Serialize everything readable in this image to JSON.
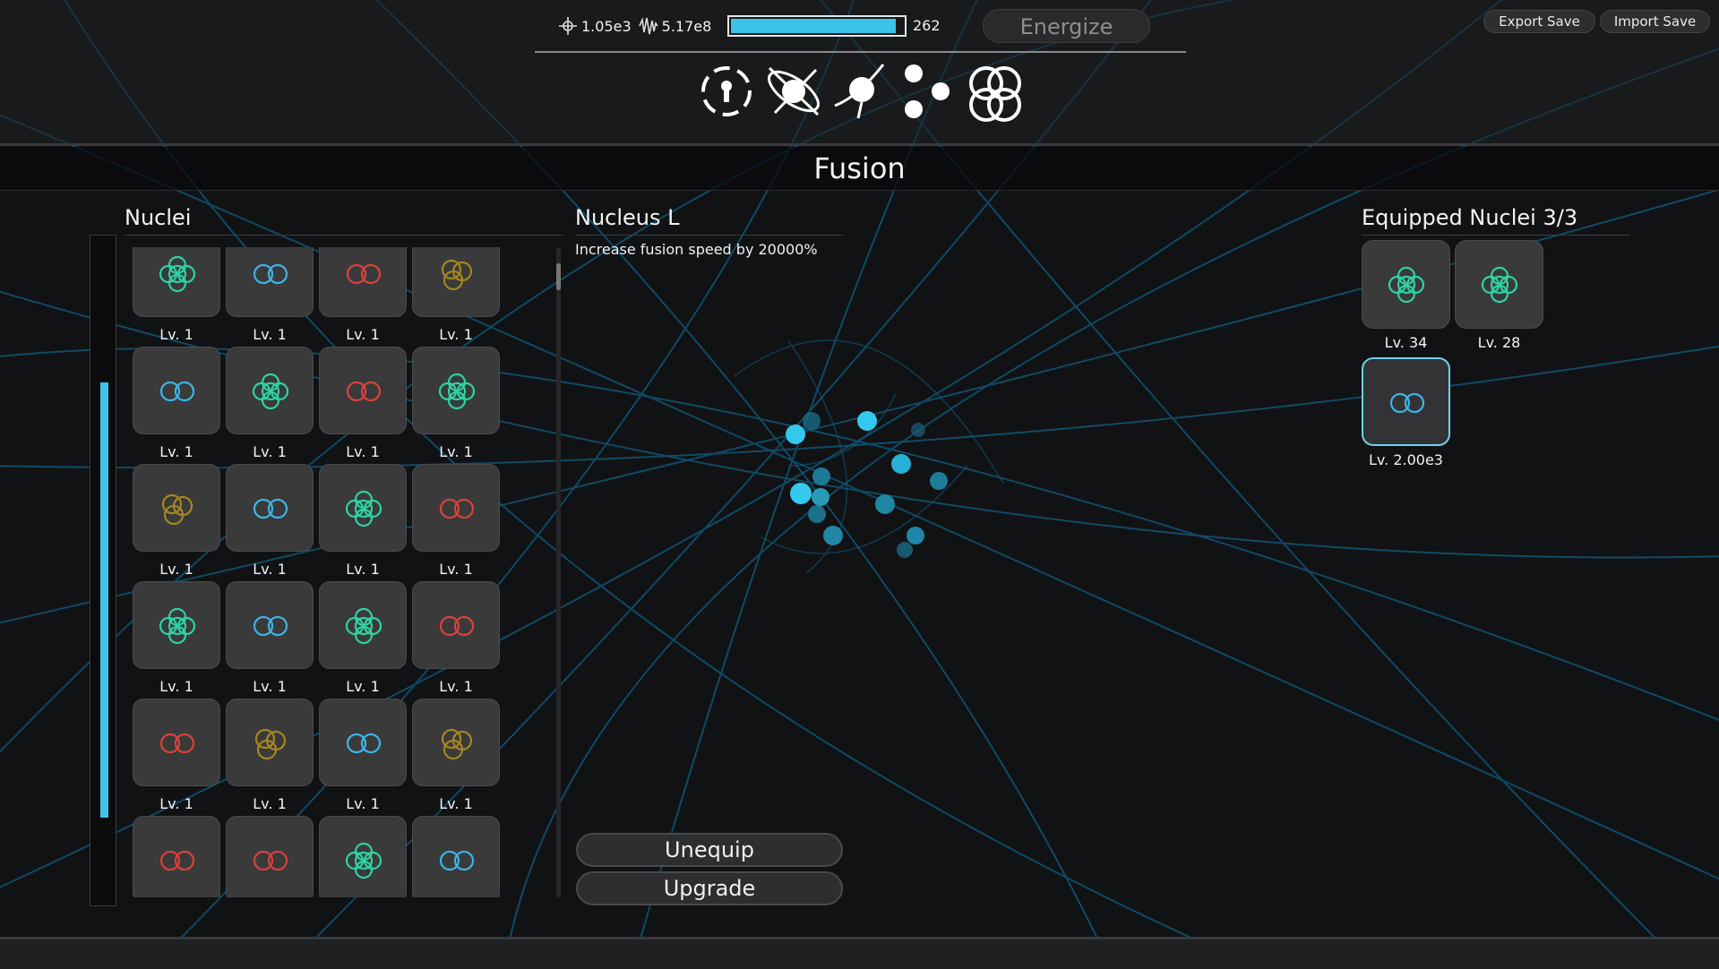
{
  "colors": {
    "accent": "#3cc3ea",
    "nucleus_green": "#2ed3a3",
    "nucleus_blue": "#3cb5e6",
    "nucleus_red": "#d9423a",
    "nucleus_gold": "#a5861f",
    "background": "#111214"
  },
  "header": {
    "stat1_icon": "crosshair-atom-icon",
    "stat1_value": "1.05e3",
    "stat2_icon": "wave-icon",
    "stat2_value": "5.17e8",
    "energy_fill_fraction": 0.96,
    "energy_value": "262",
    "energize_label": "Energize",
    "export_label": "Export Save",
    "import_label": "Import Save"
  },
  "nav": [
    {
      "name": "keyhole-icon"
    },
    {
      "name": "orbit-icon"
    },
    {
      "name": "comet-icon"
    },
    {
      "name": "particles-icon"
    },
    {
      "name": "fusion-icon"
    }
  ],
  "page_title": "Fusion",
  "inventory": {
    "title": "Nuclei",
    "scroll_fraction": 0.65,
    "rows": [
      [
        {
          "type": "quad",
          "color": "green",
          "level": "Lv. 1"
        },
        {
          "type": "pair",
          "color": "blue",
          "level": "Lv. 1"
        },
        {
          "type": "pair",
          "color": "red",
          "level": "Lv. 1"
        },
        {
          "type": "tri",
          "color": "gold",
          "level": "Lv. 1"
        }
      ],
      [
        {
          "type": "pair",
          "color": "blue",
          "level": "Lv. 1"
        },
        {
          "type": "quad",
          "color": "green",
          "level": "Lv. 1"
        },
        {
          "type": "pair",
          "color": "red",
          "level": "Lv. 1"
        },
        {
          "type": "quad",
          "color": "green",
          "level": "Lv. 1"
        }
      ],
      [
        {
          "type": "tri",
          "color": "gold",
          "level": "Lv. 1"
        },
        {
          "type": "pair",
          "color": "blue",
          "level": "Lv. 1"
        },
        {
          "type": "quad",
          "color": "green",
          "level": "Lv. 1"
        },
        {
          "type": "pair",
          "color": "red",
          "level": "Lv. 1"
        }
      ],
      [
        {
          "type": "quad",
          "color": "green",
          "level": "Lv. 1"
        },
        {
          "type": "pair",
          "color": "blue",
          "level": "Lv. 1"
        },
        {
          "type": "quad",
          "color": "green",
          "level": "Lv. 1"
        },
        {
          "type": "pair",
          "color": "red",
          "level": "Lv. 1"
        }
      ],
      [
        {
          "type": "pair",
          "color": "red",
          "level": "Lv. 1"
        },
        {
          "type": "tri",
          "color": "gold",
          "level": "Lv. 1"
        },
        {
          "type": "pair",
          "color": "blue",
          "level": "Lv. 1"
        },
        {
          "type": "tri",
          "color": "gold",
          "level": "Lv. 1"
        }
      ],
      [
        {
          "type": "pair",
          "color": "red",
          "level": ""
        },
        {
          "type": "pair",
          "color": "red",
          "level": ""
        },
        {
          "type": "quad",
          "color": "green",
          "level": ""
        },
        {
          "type": "pair",
          "color": "blue",
          "level": ""
        }
      ]
    ]
  },
  "detail": {
    "title": "Nucleus L",
    "description": "Increase fusion speed by 20000%",
    "unequip_label": "Unequip",
    "upgrade_label": "Upgrade"
  },
  "equipped": {
    "title": "Equipped Nuclei 3/3",
    "items": [
      {
        "type": "quad",
        "color": "green",
        "level": "Lv. 34",
        "selected": false
      },
      {
        "type": "quad",
        "color": "green",
        "level": "Lv. 28",
        "selected": false
      },
      {
        "type": "pair",
        "color": "blue",
        "level": "Lv. 2.00e3",
        "selected": true
      }
    ]
  }
}
